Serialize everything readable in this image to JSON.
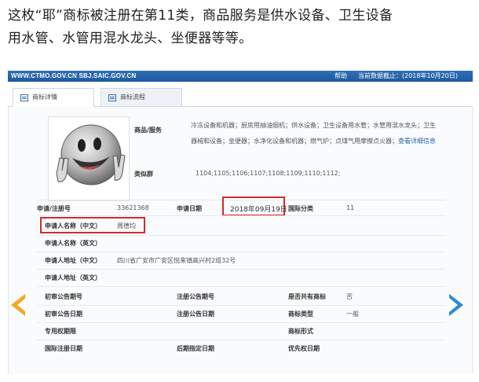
{
  "caption": {
    "line1": "这枚“耶”商标被注册在第11类，商品服务是供水设备、卫生设备",
    "line2": "用水管、水管用混水龙头、坐便器等等。"
  },
  "topbar": {
    "url": "WWW.CTMO.GOV.CN SBJ.SAIC.GOV.CN",
    "help": "帮助",
    "db_date": "当前数据截止：(2018年10月20日)"
  },
  "tabs": [
    {
      "label": "商标详情",
      "active": true
    },
    {
      "label": "商标流程",
      "active": false
    }
  ],
  "details": {
    "goods_label": "商品/服务",
    "goods_line1": "冷冻设备和机器；厨房用抽油烟机；供水设备；卫生设备用水管；水管用混水龙头；卫生",
    "goods_line2": "器械和设备；坐便器；水净化设备和机器；燃气炉；点煤气用摩擦点火器；",
    "goods_more": "查看详细信息",
    "similar_label": "类似群",
    "similar_value": "1104;1105;1106;1107;1108;1109;1110;1112;",
    "reg_no_label": "申请/注册号",
    "reg_no_value": "33621368",
    "apply_date_label": "申请日期",
    "apply_date_value": "2018年09月19日",
    "intl_class_label": "国际分类",
    "intl_class_value": "11",
    "applicant_cn_label": "申请人名称（中文）",
    "applicant_cn_value": "周德均",
    "applicant_en_label": "申请人名称（英文）",
    "address_cn_label": "申请人地址（中文）",
    "address_cn_value": "四川省广安市广安区悦来镇高兴村2组32号",
    "address_en_label": "申请人地址（英文）",
    "prelim_no_label": "初审公告期号",
    "reg_pub_no_label": "注册公告期号",
    "shared_label": "是否共有商标",
    "shared_value": "否",
    "prelim_date_label": "初审公告日期",
    "reg_pub_date_label": "注册公告日期",
    "type_label": "商标类型",
    "type_value": "一般",
    "exclusive_label": "专用权期限",
    "form_label": "商标形式",
    "intl_date_label": "国际注册日期",
    "later_date_label": "后期指定日期",
    "priority_date_label": "优先权日期"
  }
}
